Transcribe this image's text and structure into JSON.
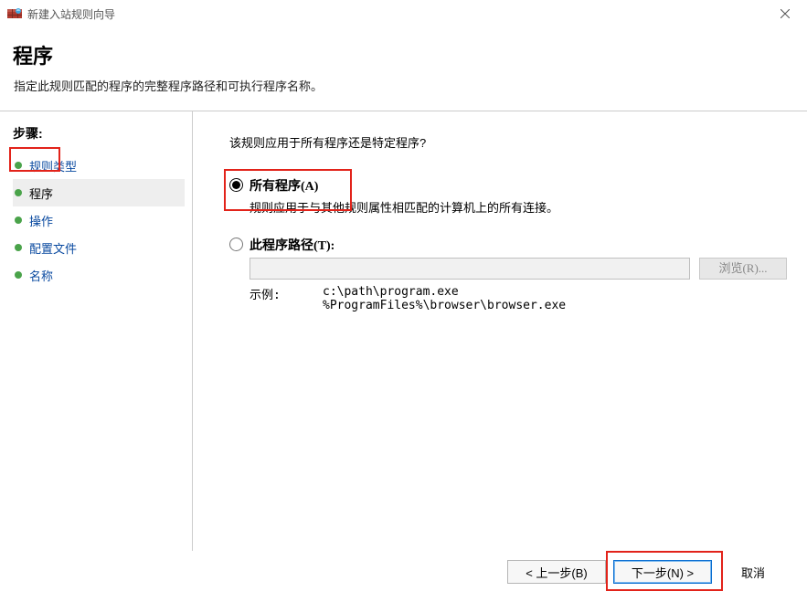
{
  "titlebar": {
    "title": "新建入站规则向导"
  },
  "header": {
    "title": "程序",
    "subtitle": "指定此规则匹配的程序的完整程序路径和可执行程序名称。"
  },
  "steps": {
    "heading": "步骤:",
    "items": [
      {
        "label": "规则类型",
        "current": false
      },
      {
        "label": "程序",
        "current": true
      },
      {
        "label": "操作",
        "current": false
      },
      {
        "label": "配置文件",
        "current": false
      },
      {
        "label": "名称",
        "current": false
      }
    ]
  },
  "content": {
    "question": "该规则应用于所有程序还是特定程序?",
    "opt_all": {
      "label": "所有程序(A)",
      "desc": "规则应用于与其他规则属性相匹配的计算机上的所有连接。",
      "selected": true
    },
    "opt_path": {
      "label": "此程序路径(T):",
      "selected": false,
      "value": "",
      "browse_label": "浏览(R)..."
    },
    "example": {
      "label": "示例:",
      "line1": "c:\\path\\program.exe",
      "line2": "%ProgramFiles%\\browser\\browser.exe"
    }
  },
  "footer": {
    "back": "< 上一步(B)",
    "next": "下一步(N) >",
    "cancel": "取消"
  }
}
